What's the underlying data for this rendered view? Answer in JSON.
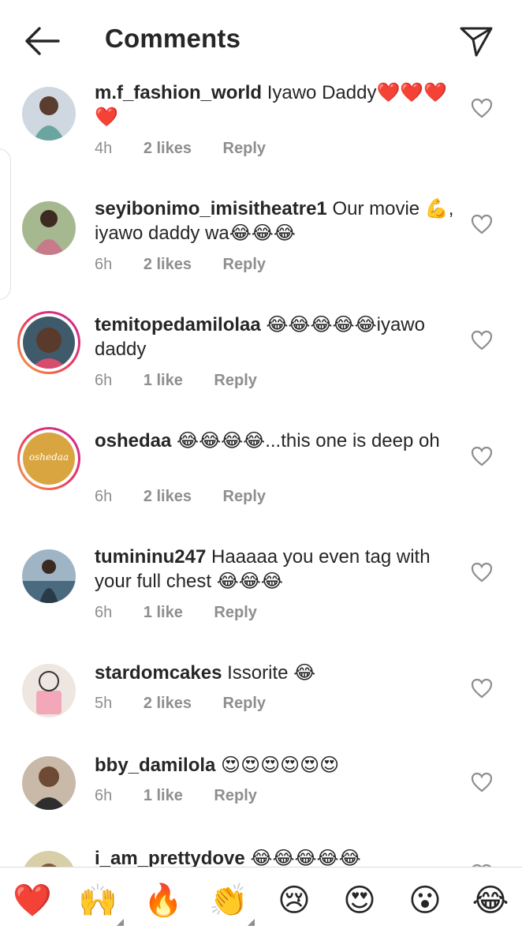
{
  "header": {
    "title": "Comments"
  },
  "comments": [
    {
      "username": "m.f_fashion_world",
      "text": "Iyawo Daddy❤️❤️❤️❤️",
      "time": "4h",
      "likes": "2 likes",
      "reply": "Reply",
      "avatar_color": "#7a9ab0"
    },
    {
      "username": "seyibonimo_imisitheatre1",
      "text": "Our movie 💪, iyawo daddy wa😂😂😂",
      "time": "6h",
      "likes": "2 likes",
      "reply": "Reply",
      "avatar_color": "#8aa070"
    },
    {
      "username": "temitopedamilolaa",
      "text": "😂😂😂😂😂iyawo daddy",
      "time": "6h",
      "likes": "1 like",
      "reply": "Reply",
      "avatar_color": "#5a3a2a"
    },
    {
      "username": "oshedaa",
      "text": "😂😂😂😂...this one is deep oh",
      "time": "6h",
      "likes": "2 likes",
      "reply": "Reply",
      "avatar_color": "#d9a541",
      "avatar_text": "oshedaa"
    },
    {
      "username": "tumininu247",
      "text": "Haaaaa you even tag with your full chest 😂😂😂",
      "time": "6h",
      "likes": "1 like",
      "reply": "Reply",
      "avatar_color": "#5f7f96"
    },
    {
      "username": "stardomcakes",
      "text": "Issorite 😂",
      "time": "5h",
      "likes": "2 likes",
      "reply": "Reply",
      "avatar_color": "#d9c9c0"
    },
    {
      "username": "bby_damilola",
      "text": "😍😍😍😍😍😍",
      "time": "6h",
      "likes": "1 like",
      "reply": "Reply",
      "avatar_color": "#6e5a4e"
    },
    {
      "username": "i_am_prettydove",
      "text": "😂😂😂😂😂",
      "time": "",
      "likes": "",
      "reply": "",
      "avatar_color": "#c8b88a"
    }
  ],
  "emoji_bar": [
    "❤️",
    "🙌",
    "🔥",
    "👏",
    "😢",
    "😍",
    "😮",
    "😂"
  ],
  "colors": {
    "text": "#262626",
    "meta": "#8e8e8e",
    "divider": "#dbdbdb"
  }
}
